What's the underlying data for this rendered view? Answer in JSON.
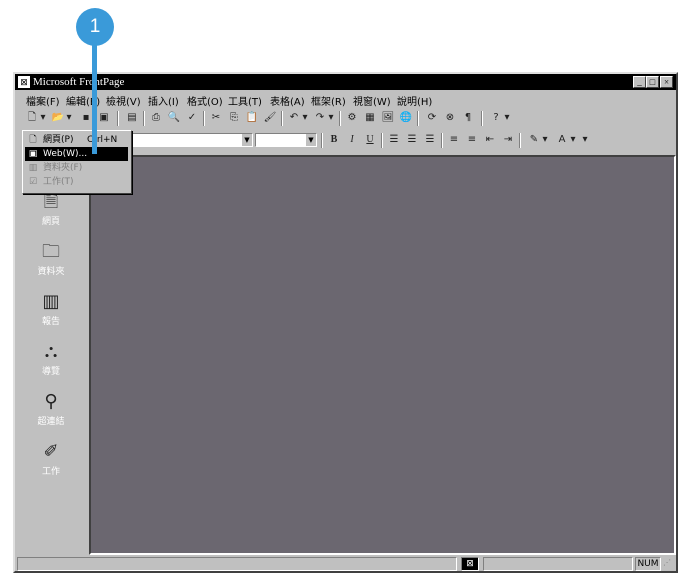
{
  "callout": {
    "number": "1"
  },
  "window": {
    "title": "Microsoft FrontPage",
    "controls": {
      "minimize": "_",
      "maximize": "□",
      "close": "×"
    }
  },
  "menubar": [
    {
      "label": "檔案(F)"
    },
    {
      "label": "編輯(E)"
    },
    {
      "label": "檢視(V)"
    },
    {
      "label": "插入(I)"
    },
    {
      "label": "格式(O)"
    },
    {
      "label": "工具(T)"
    },
    {
      "label": "表格(A)"
    },
    {
      "label": "框架(R)"
    },
    {
      "label": "視窗(W)"
    },
    {
      "label": "說明(H)"
    }
  ],
  "formatting": {
    "bold": "B",
    "italic": "I",
    "underline": "U"
  },
  "dropdown": {
    "items": [
      {
        "label": "網頁(P)",
        "shortcut": "Ctrl+N",
        "icon": "page-icon",
        "state": "normal"
      },
      {
        "label": "Web(W)...",
        "shortcut": "",
        "icon": "web-icon",
        "state": "selected"
      },
      {
        "label": "資料夾(F)",
        "shortcut": "",
        "icon": "folder-icon",
        "state": "disabled"
      },
      {
        "label": "工作(T)",
        "shortcut": "",
        "icon": "task-icon",
        "state": "disabled"
      }
    ]
  },
  "views": [
    {
      "label": "網頁",
      "icon": "page-view-icon"
    },
    {
      "label": "資料夾",
      "icon": "folders-view-icon"
    },
    {
      "label": "報告",
      "icon": "reports-view-icon"
    },
    {
      "label": "導覽",
      "icon": "navigation-view-icon"
    },
    {
      "label": "超連結",
      "icon": "hyperlinks-view-icon"
    },
    {
      "label": "工作",
      "icon": "tasks-view-icon"
    }
  ],
  "statusbar": {
    "num": "NUM"
  },
  "colors": {
    "workspace": "#6b6770",
    "callout": "#3a9ad9"
  }
}
